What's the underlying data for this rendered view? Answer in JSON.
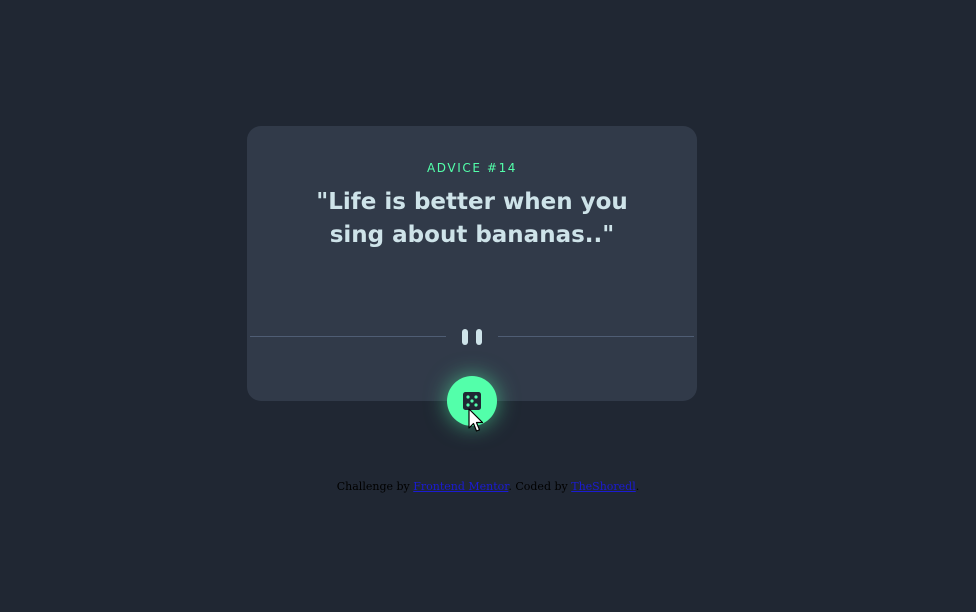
{
  "card": {
    "advice_label": "ADVICE #14",
    "advice_text": "\"Life is better when you sing about bananas..\""
  },
  "dice_button": {
    "icon": "dice-icon"
  },
  "divider": {
    "icon": "pause-icon"
  },
  "attribution": {
    "prefix": "Challenge by ",
    "challenge_link": "Frontend Mentor",
    "middle": ". Coded by ",
    "author_link": "TheShoredl",
    "suffix": "."
  },
  "colors": {
    "background": "#202733",
    "card": "#313a49",
    "accent": "#53ffaa",
    "text": "#cee3e9",
    "divider": "#4f5d74"
  }
}
